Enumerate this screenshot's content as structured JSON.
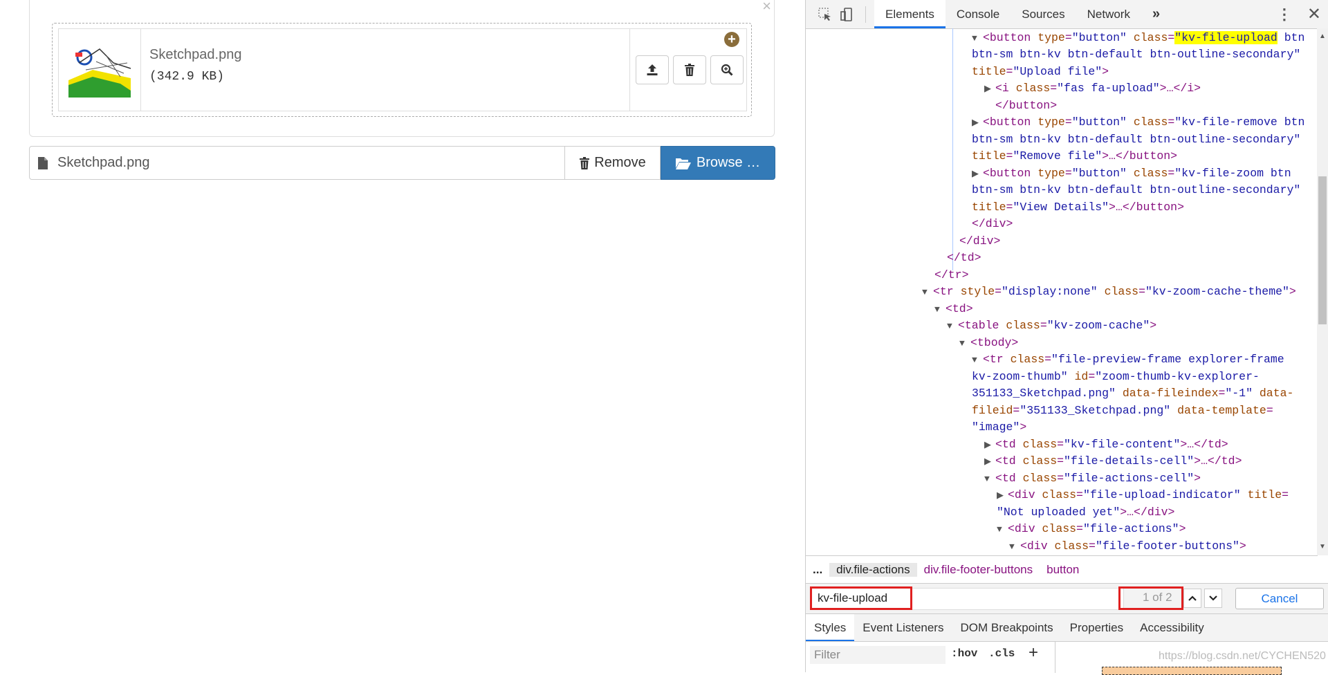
{
  "upload": {
    "close_glyph": "×",
    "file_name": "Sketchpad.png",
    "file_size": "(342.9 KB)",
    "caption_name": "Sketchpad.png",
    "remove_label": "Remove",
    "browse_label": "Browse …",
    "browse_color": "#337ab7"
  },
  "devtools": {
    "tabs": [
      "Elements",
      "Console",
      "Sources",
      "Network"
    ],
    "more_tabs": "»",
    "code": {
      "l1": "\"kv-file-upload",
      "l1b": "btn",
      "l2": "btn-sm btn-kv btn-default btn-outline-secondary\"",
      "l3v": "\"Upload file\"",
      "l4a": "\"fas fa-upload\"",
      "l6": "\"kv-file-remove btn",
      "l7": "btn-sm btn-kv btn-default btn-outline-secondary\"",
      "l8v": "\"Remove file\"",
      "l9": "\"kv-file-zoom btn",
      "l10": "btn-sm btn-kv btn-default btn-outline-secondary\"",
      "l11v": "\"View Details\"",
      "tr_style": "\"display:none\"",
      "tr_class": "\"kv-zoom-cache-theme\"",
      "table_class": "\"kv-zoom-cache\"",
      "tr2_class": "\"file-preview-frame explorer-frame",
      "tr2_l2a": "kv-zoom-thumb\"",
      "tr2_id": "\"zoom-thumb-kv-explorer-",
      "tr2_l3a": "351133_Sketchpad.png\"",
      "tr2_fidx": "\"-1\"",
      "tr2_l4v": "\"351133_Sketchpad.png\"",
      "tr2_tmpl": "\"image\"",
      "td1": "\"kv-file-content\"",
      "td2": "\"file-details-cell\"",
      "td3": "\"file-actions-cell\"",
      "div1": "\"file-upload-indicator\"",
      "div1_title": "\"Not uploaded yet\"",
      "div2": "\"file-actions\"",
      "div3": "\"file-footer-buttons\""
    },
    "breadcrumbs": [
      "...",
      "div.file-actions",
      "div.file-footer-buttons",
      "button"
    ],
    "search": {
      "value": "kv-file-upload",
      "count": "1 of 2",
      "cancel": "Cancel"
    },
    "subtabs": [
      "Styles",
      "Event Listeners",
      "DOM Breakpoints",
      "Properties",
      "Accessibility"
    ],
    "filter_placeholder": "Filter",
    "hov": ":hov",
    "cls": ".cls",
    "plus": "+",
    "watermark": "https://blog.csdn.net/CYCHEN520"
  }
}
